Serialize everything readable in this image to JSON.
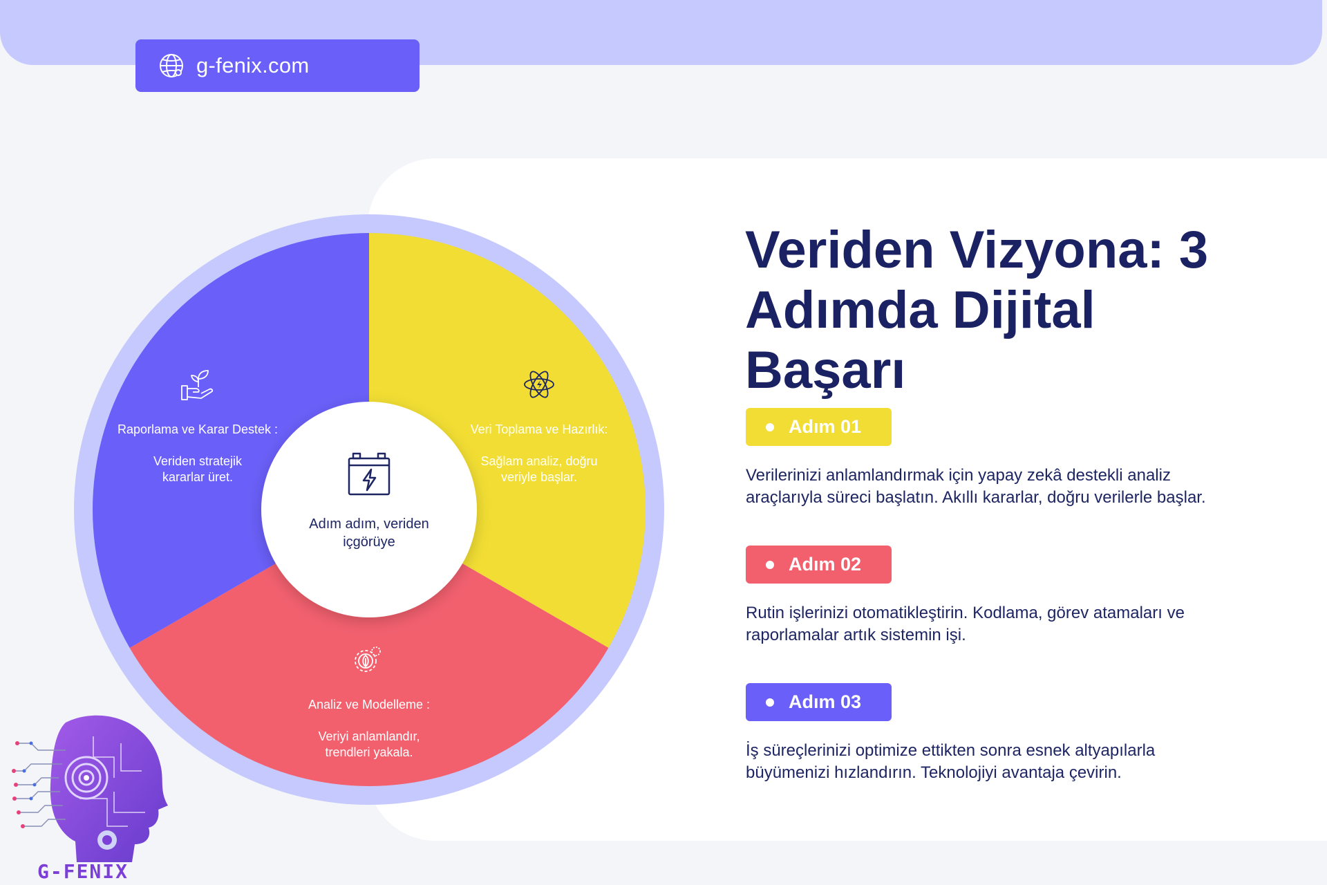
{
  "site": {
    "url": "g-fenix.com"
  },
  "headline": "Veriden Vizyona: 3 Adımda Dijital Başarı",
  "wheel": {
    "center_text": "Adım adım, veriden içgörüye",
    "segments": [
      {
        "title": "Veri Toplama ve Hazırlık:",
        "desc": "Sağlam analiz, doğru veriyle başlar.",
        "color": "#f1dd33",
        "icon": "atom-icon"
      },
      {
        "title": "Analiz ve Modelleme :",
        "desc": "Veriyi anlamlandır, trendleri yakala.",
        "color": "#f2606e",
        "icon": "gears-icon"
      },
      {
        "title": "Raporlama ve Karar Destek :",
        "desc": "Veriden stratejik kararlar üret.",
        "color": "#6a5ff8",
        "icon": "plant-in-hand-icon"
      }
    ],
    "ring_color": "#c6c9fd",
    "center_icon": "battery-bolt-icon"
  },
  "steps": [
    {
      "label": "Adım 01",
      "color": "#f1dd33",
      "text": "Verilerinizi anlamlandırmak için yapay zekâ destekli analiz araçlarıyla süreci başlatın. Akıllı kararlar, doğru verilerle başlar."
    },
    {
      "label": "Adım 02",
      "color": "#f2606e",
      "text": "Rutin işlerinizi otomatikleştirin. Kodlama, görev atamaları ve raporlamalar artık sistemin işi."
    },
    {
      "label": "Adım 03",
      "color": "#6a5ff8",
      "text": "İş süreçlerinizi optimize ettikten sonra esnek altyapılarla büyümenizi hızlandırın. Teknolojiyi avantaja çevirin."
    }
  ],
  "logo": {
    "text": "G-FENIX"
  }
}
